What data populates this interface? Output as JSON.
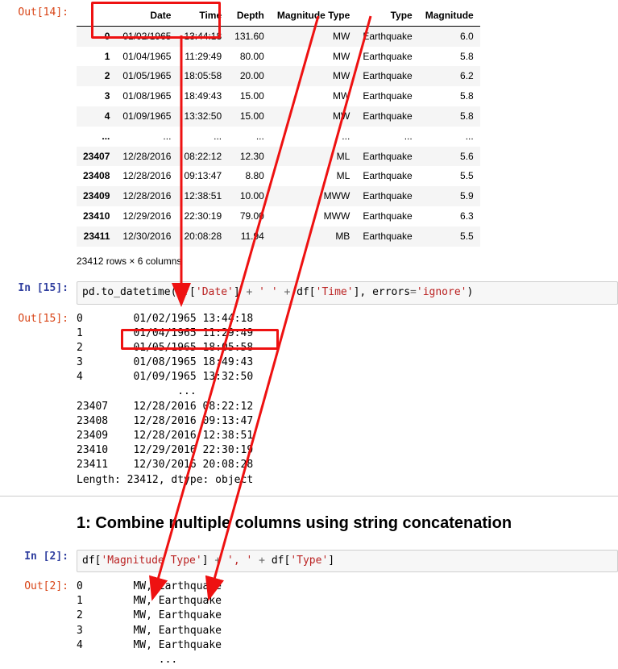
{
  "cell14": {
    "out_label": "Out[14]:",
    "columns": [
      "",
      "Date",
      "Time",
      "Depth",
      "Magnitude Type",
      "Type",
      "Magnitude"
    ],
    "rows": [
      [
        "0",
        "01/02/1965",
        "13:44:18",
        "131.60",
        "MW",
        "Earthquake",
        "6.0"
      ],
      [
        "1",
        "01/04/1965",
        "11:29:49",
        "80.00",
        "MW",
        "Earthquake",
        "5.8"
      ],
      [
        "2",
        "01/05/1965",
        "18:05:58",
        "20.00",
        "MW",
        "Earthquake",
        "6.2"
      ],
      [
        "3",
        "01/08/1965",
        "18:49:43",
        "15.00",
        "MW",
        "Earthquake",
        "5.8"
      ],
      [
        "4",
        "01/09/1965",
        "13:32:50",
        "15.00",
        "MW",
        "Earthquake",
        "5.8"
      ],
      [
        "...",
        "...",
        "...",
        "...",
        "...",
        "...",
        "..."
      ],
      [
        "23407",
        "12/28/2016",
        "08:22:12",
        "12.30",
        "ML",
        "Earthquake",
        "5.6"
      ],
      [
        "23408",
        "12/28/2016",
        "09:13:47",
        "8.80",
        "ML",
        "Earthquake",
        "5.5"
      ],
      [
        "23409",
        "12/28/2016",
        "12:38:51",
        "10.00",
        "MWW",
        "Earthquake",
        "5.9"
      ],
      [
        "23410",
        "12/29/2016",
        "22:30:19",
        "79.00",
        "MWW",
        "Earthquake",
        "6.3"
      ],
      [
        "23411",
        "12/30/2016",
        "20:08:28",
        "11.94",
        "MB",
        "Earthquake",
        "5.5"
      ]
    ],
    "shape_note": "23412 rows × 6 columns"
  },
  "cell15": {
    "in_label": "In [15]:",
    "out_label": "Out[15]:",
    "code_parts": {
      "p1": "pd.to_datetime(df[",
      "s1": "'Date'",
      "p2": "] ",
      "op1": "+",
      "s2": " ' ' ",
      "op2": "+",
      "p3": " df[",
      "s3": "'Time'",
      "p4": "], errors",
      "op3": "=",
      "s4": "'ignore'",
      "p5": ")"
    },
    "output_lines": [
      "0        01/02/1965 13:44:18",
      "1        01/04/1965 11:29:49",
      "2        01/05/1965 18:05:58",
      "3        01/08/1965 18:49:43",
      "4        01/09/1965 13:32:50",
      "                ...         ",
      "23407    12/28/2016 08:22:12",
      "23408    12/28/2016 09:13:47",
      "23409    12/28/2016 12:38:51",
      "23410    12/29/2016 22:30:19",
      "23411    12/30/2016 20:08:28",
      "Length: 23412, dtype: object"
    ]
  },
  "heading1": "1: Combine multiple columns using string concatenation",
  "cell2": {
    "in_label": "In [2]:",
    "out_label": "Out[2]:",
    "code_parts": {
      "p1": "df[",
      "s1": "'Magnitude Type'",
      "p2": "] ",
      "op1": "+",
      "s2": " ', ' ",
      "op2": "+",
      "p3": " df[",
      "s3": "'Type'",
      "p4": "]"
    },
    "output_lines": [
      "0        MW, Earthquake",
      "1        MW, Earthquake",
      "2        MW, Earthquake",
      "3        MW, Earthquake",
      "4        MW, Earthquake",
      "             ...       "
    ]
  }
}
